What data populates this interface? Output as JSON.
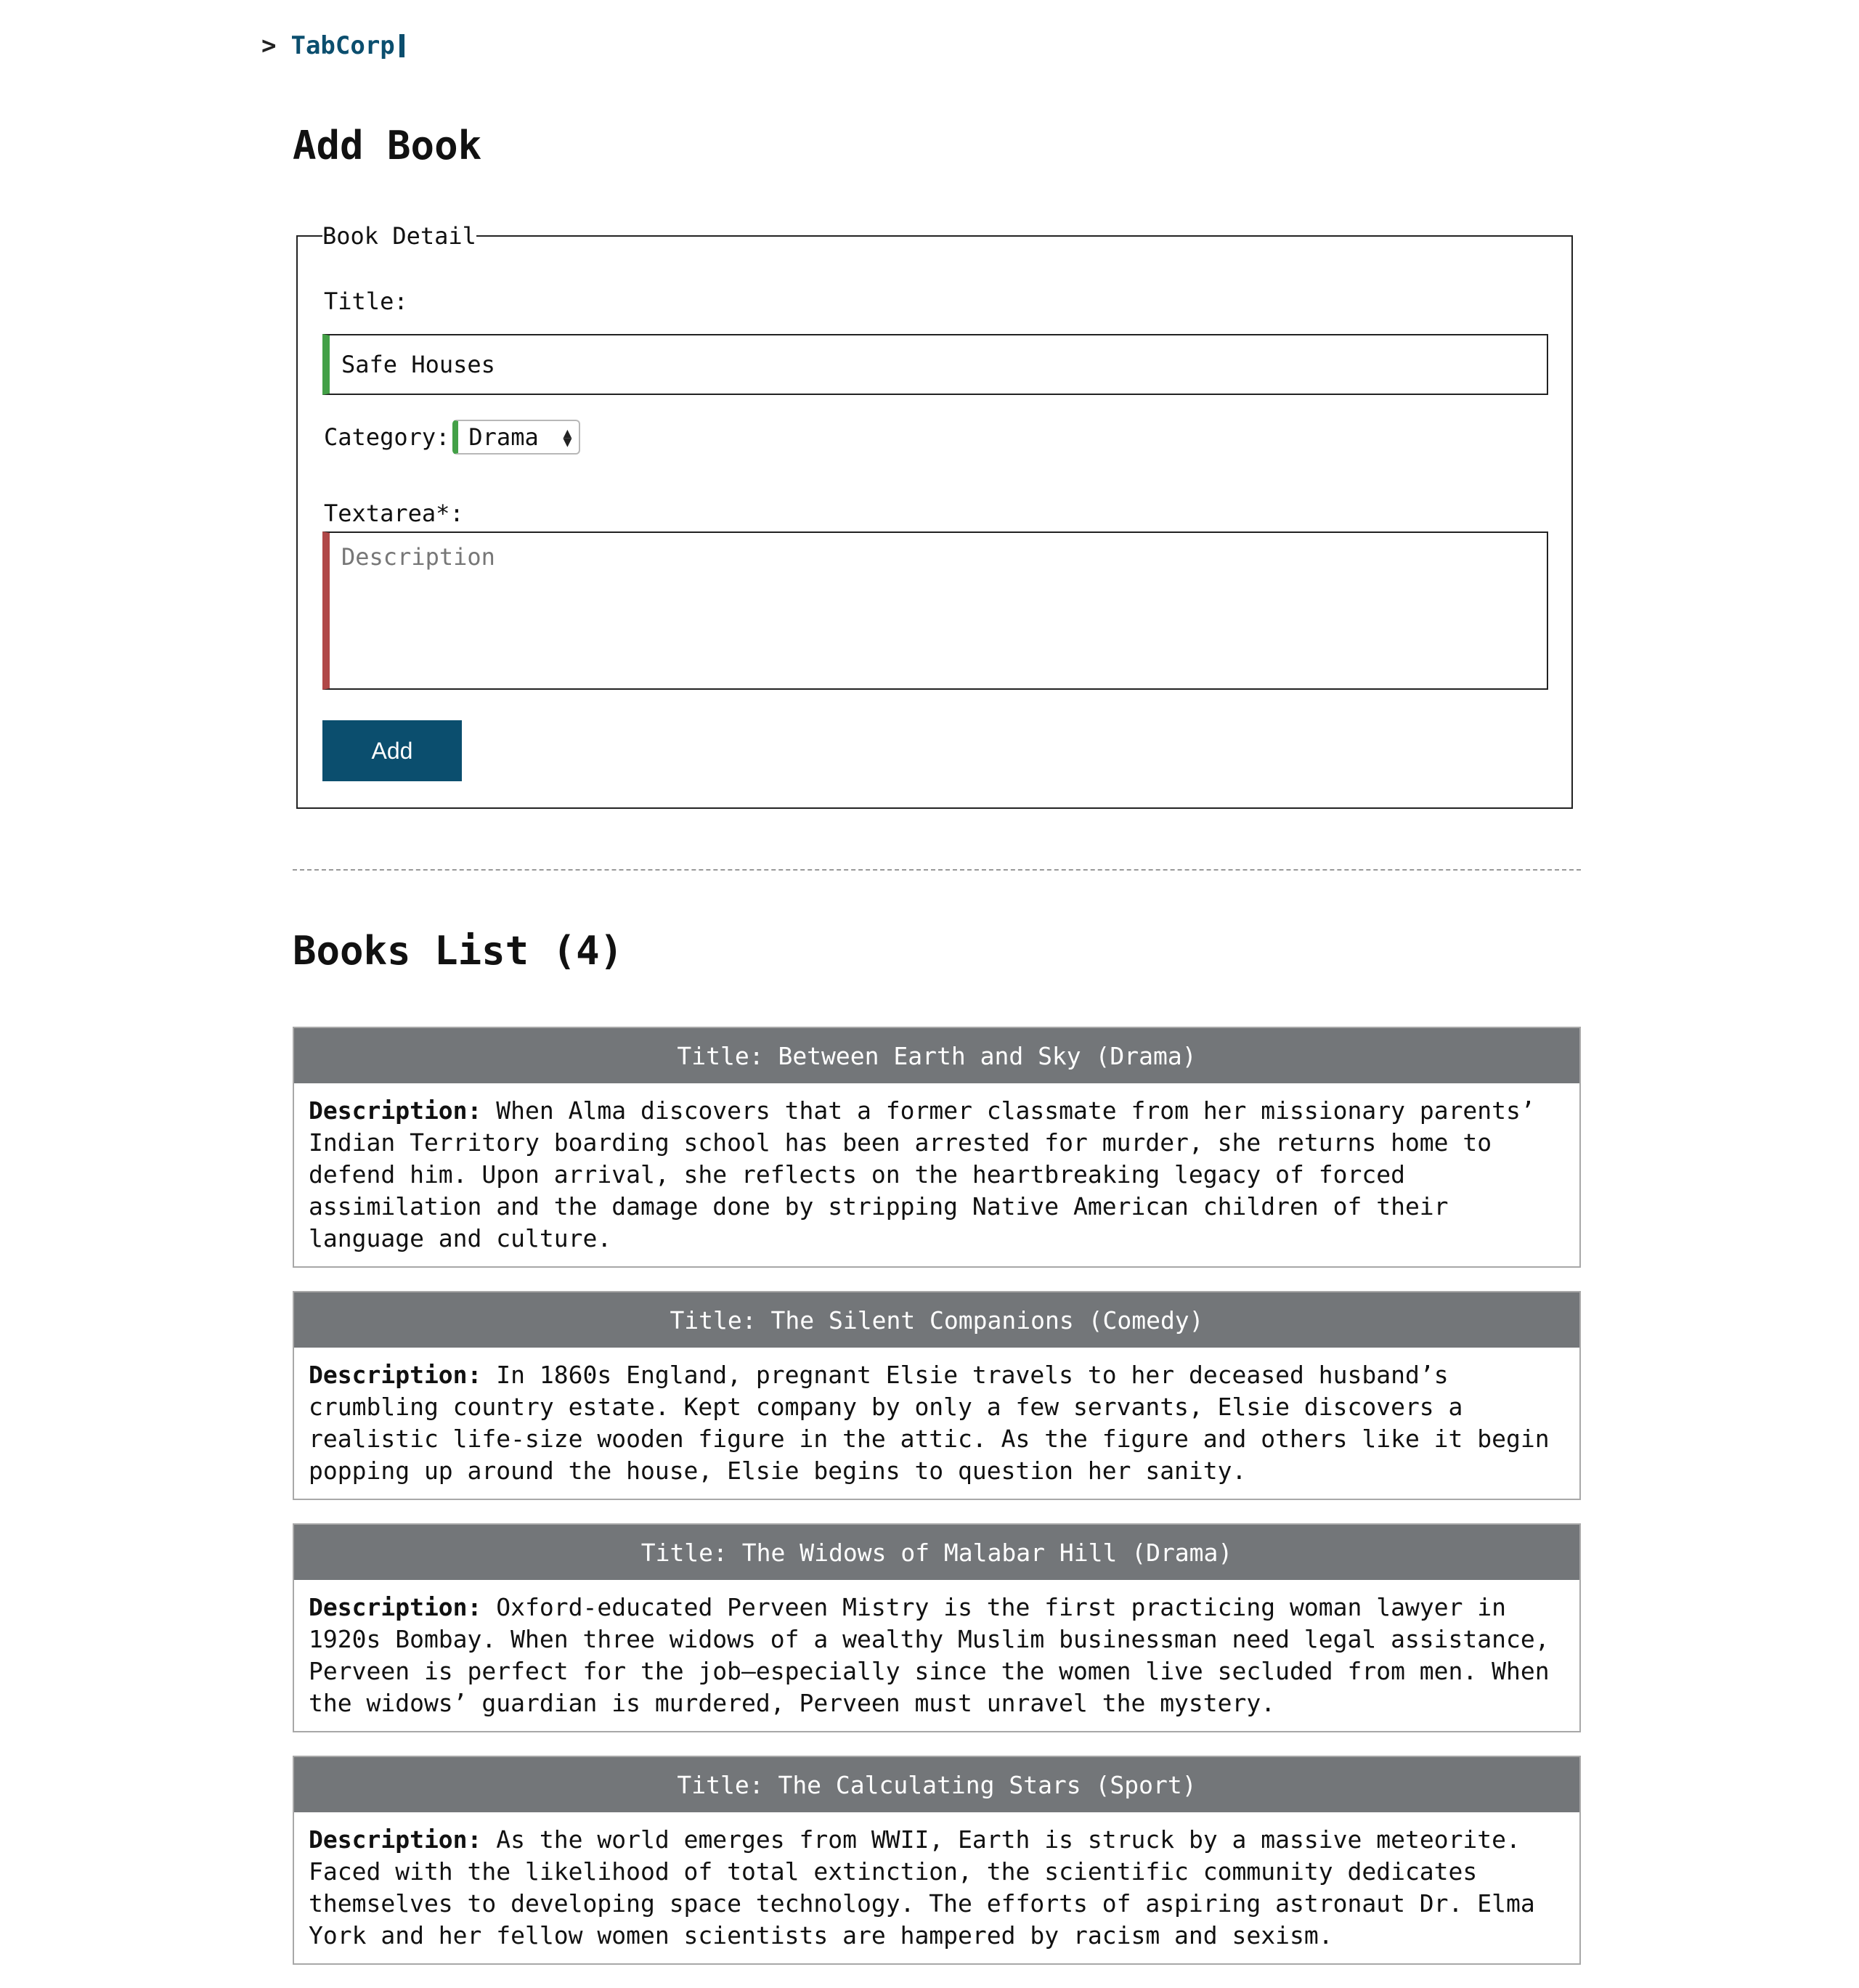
{
  "brand": {
    "prompt": ">",
    "name": "TabCorp"
  },
  "form": {
    "heading": "Add Book",
    "legend": "Book Detail",
    "title_label": "Title:",
    "title_value": "Safe Houses",
    "category_label": "Category:",
    "category_value": "Drama",
    "description_label": "Textarea*:",
    "description_placeholder": "Description",
    "submit_label": "Add"
  },
  "list": {
    "heading": "Books List (4)",
    "description_prefix": "Description:",
    "books": [
      {
        "header": "Title: Between Earth and Sky (Drama)",
        "description": "When Alma discovers that a former classmate from her missionary parents’ Indian Territory boarding school has been arrested for murder, she returns home to defend him. Upon arrival, she reflects on the heartbreaking legacy of forced assimilation and the damage done by stripping Native American children of their language and culture."
      },
      {
        "header": "Title: The Silent Companions (Comedy)",
        "description": "In 1860s England, pregnant Elsie travels to her deceased husband’s crumbling country estate. Kept company by only a few servants, Elsie discovers a realistic life-size wooden figure in the attic. As the figure and others like it begin popping up around the house, Elsie begins to question her sanity."
      },
      {
        "header": "Title: The Widows of Malabar Hill (Drama)",
        "description": "Oxford-educated Perveen Mistry is the first practicing woman lawyer in 1920s Bombay. When three widows of a wealthy Muslim businessman need legal assistance, Perveen is perfect for the job—especially since the women live secluded from men. When the widows’ guardian is murdered, Perveen must unravel the mystery."
      },
      {
        "header": "Title: The Calculating Stars (Sport)",
        "description": "As the world emerges from WWII, Earth is struck by a massive meteorite. Faced with the likelihood of total extinction, the scientific community dedicates themselves to developing space technology. The efforts of aspiring astronaut Dr. Elma York and her fellow women scientists are hampered by racism and sexism."
      }
    ]
  },
  "colors": {
    "brand": "#0b4e6e",
    "valid": "#43a047",
    "invalid": "#b04848",
    "card_header": "#737679"
  }
}
